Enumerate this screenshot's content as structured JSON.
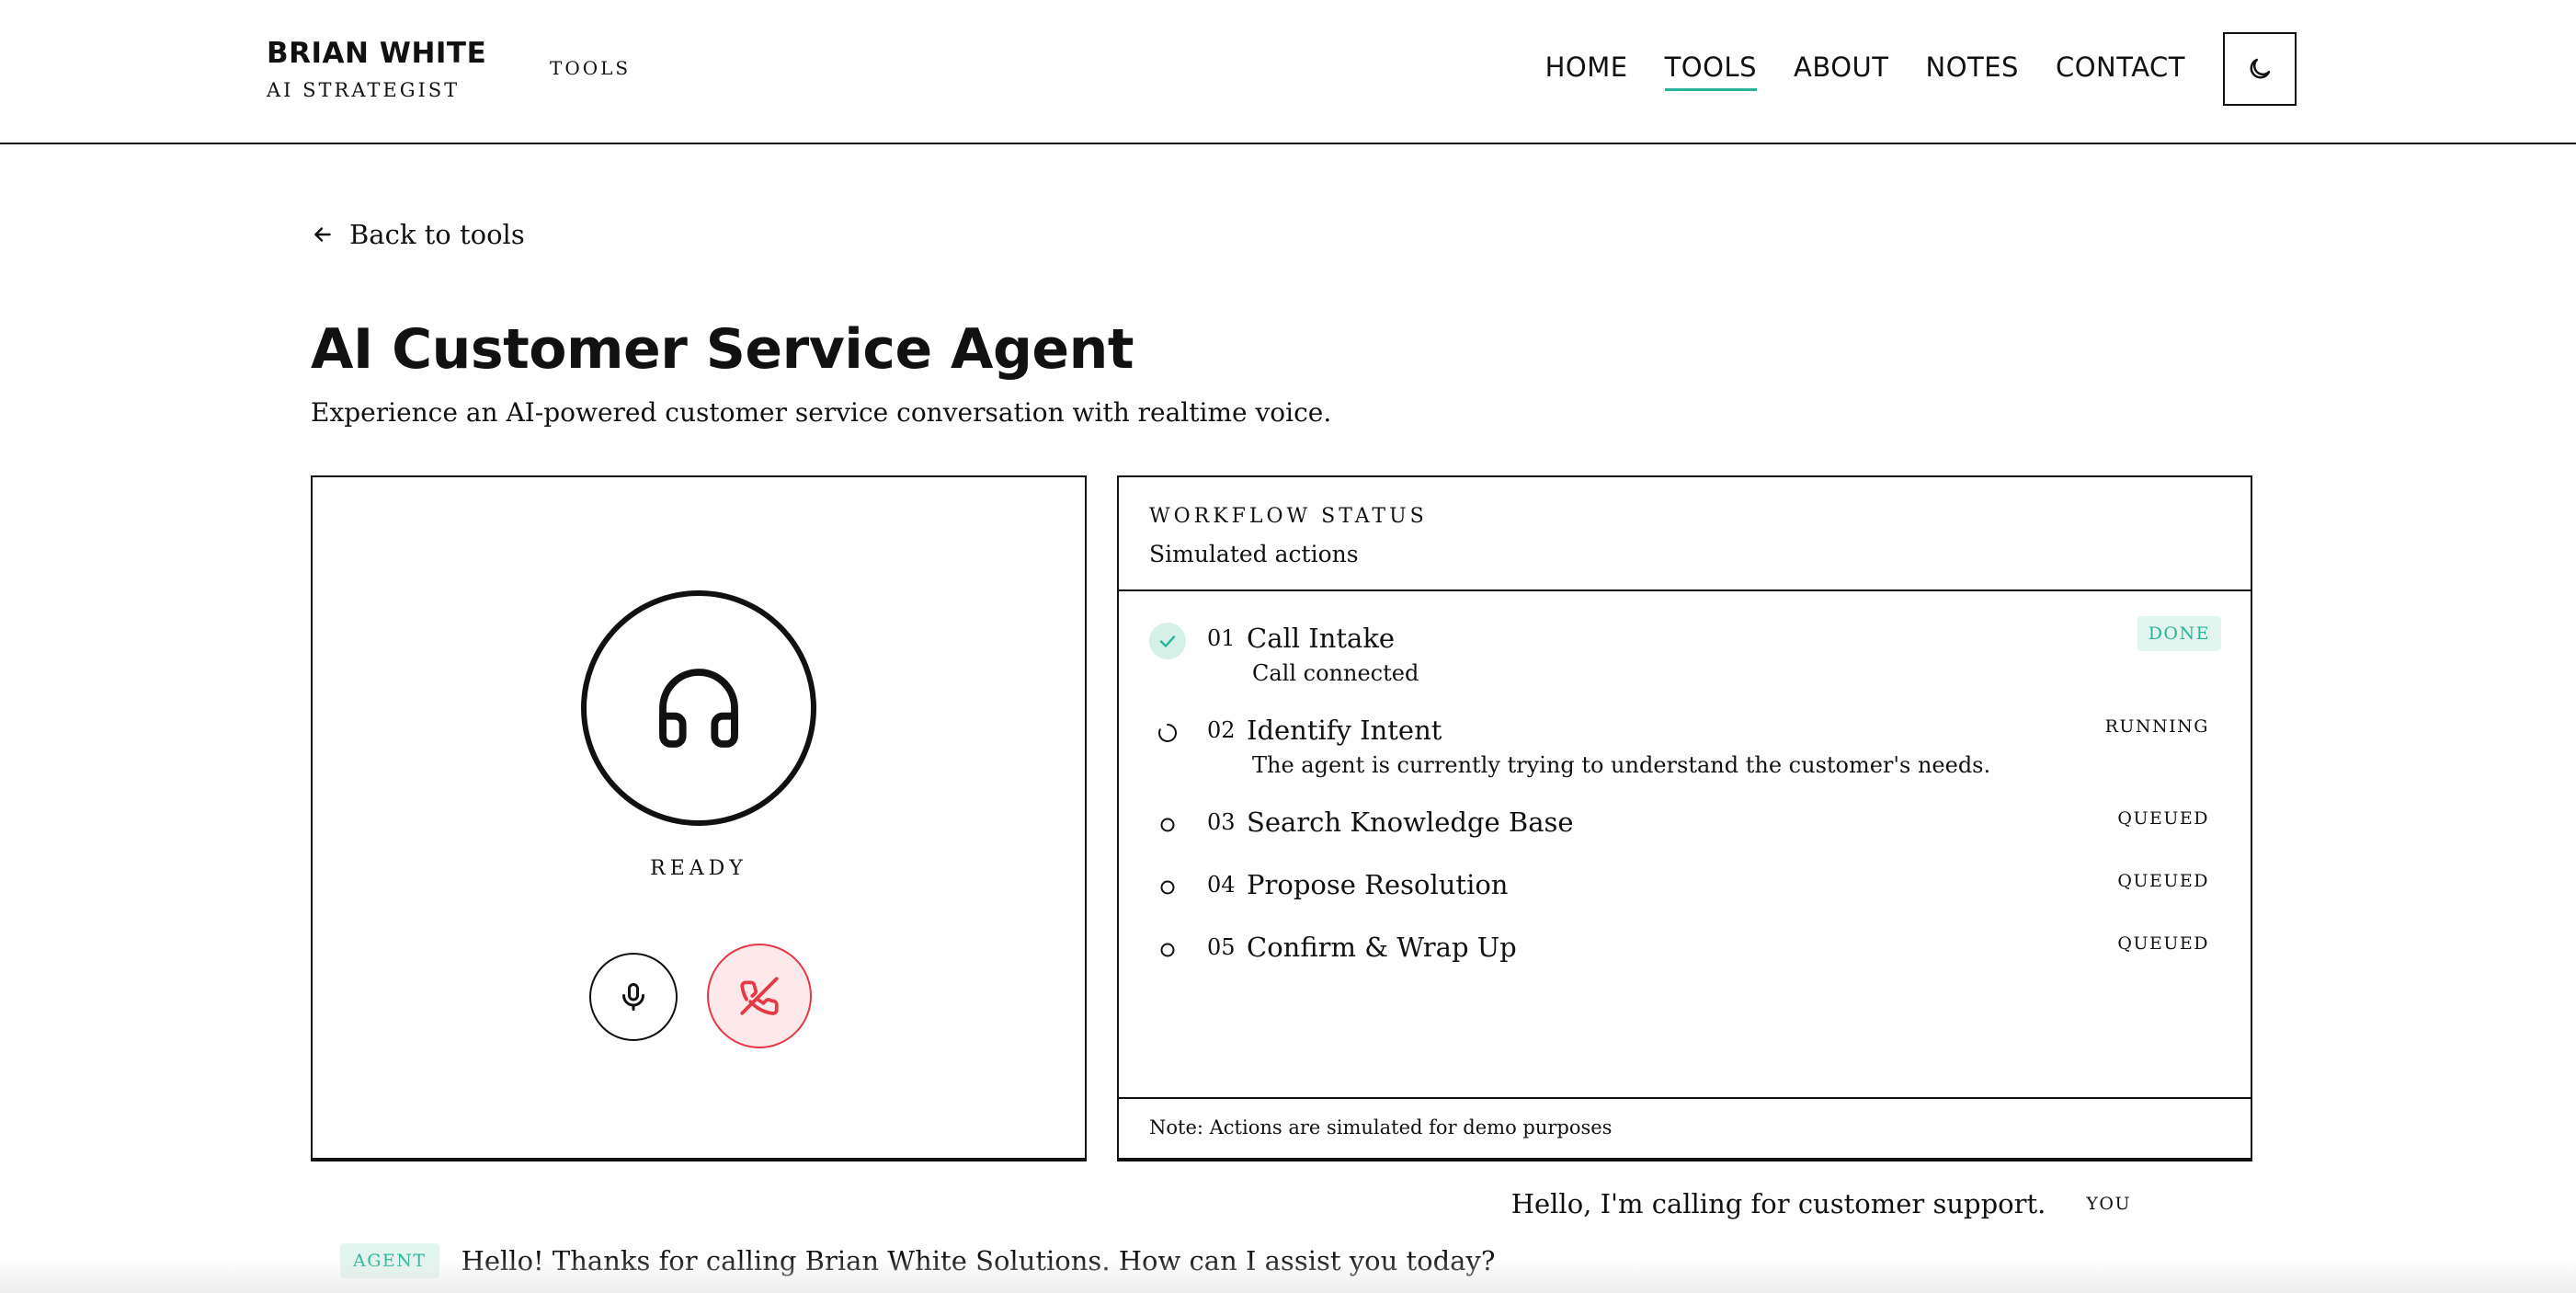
{
  "header": {
    "brand_name": "BRIAN WHITE",
    "brand_sub": "AI STRATEGIST",
    "crumb": "TOOLS",
    "nav": [
      "HOME",
      "TOOLS",
      "ABOUT",
      "NOTES",
      "CONTACT"
    ],
    "active_nav": "TOOLS",
    "theme_icon": "moon-icon"
  },
  "page": {
    "back_label": "Back to tools",
    "title": "AI Customer Service Agent",
    "subtitle": "Experience an AI-powered customer service conversation with realtime voice."
  },
  "call": {
    "avatar_icon": "headphones-icon",
    "status": "READY",
    "mic_icon": "microphone-icon",
    "end_icon": "phone-off-icon"
  },
  "workflow": {
    "title": "WORKFLOW STATUS",
    "subtitle": "Simulated actions",
    "steps": [
      {
        "num": "01",
        "name": "Call Intake",
        "desc": "Call connected",
        "status": "DONE",
        "icon": "check-icon"
      },
      {
        "num": "02",
        "name": "Identify Intent",
        "desc": "The agent is currently trying to understand the customer's needs.",
        "status": "RUNNING",
        "icon": "spinner-icon"
      },
      {
        "num": "03",
        "name": "Search Knowledge Base",
        "desc": "",
        "status": "QUEUED",
        "icon": "circle-icon"
      },
      {
        "num": "04",
        "name": "Propose Resolution",
        "desc": "",
        "status": "QUEUED",
        "icon": "circle-icon"
      },
      {
        "num": "05",
        "name": "Confirm & Wrap Up",
        "desc": "",
        "status": "QUEUED",
        "icon": "circle-icon"
      }
    ],
    "note": "Note: Actions are simulated for demo purposes"
  },
  "transcript": [
    {
      "speaker": "YOU",
      "text": "Hello, I'm calling for customer support."
    },
    {
      "speaker": "AGENT",
      "text": "Hello! Thanks for calling Brian White Solutions. How can I assist you today?"
    }
  ],
  "colors": {
    "accent": "#2bb39a",
    "accent_bg": "#e3f5ef",
    "danger": "#e53945",
    "danger_bg": "#fde8ea"
  }
}
